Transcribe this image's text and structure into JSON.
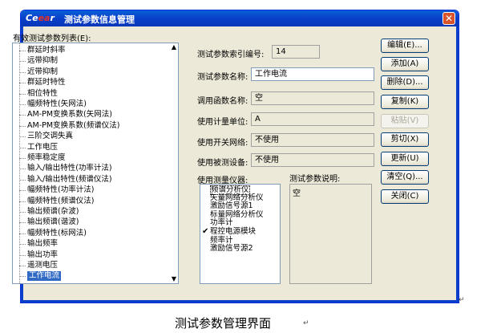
{
  "window": {
    "logo_prefix": "Ce",
    "logo_accent": "ea",
    "logo_suffix": "r",
    "title": "测试参数信息管理",
    "close_glyph": "✕"
  },
  "param_list": {
    "label": "有效测试参数列表(E):",
    "items": [
      "群延时斜率",
      "远带抑制",
      "近带抑制",
      "群延时特性",
      "相位特性",
      "幅频特性(矢网法)",
      "AM-PM变换系数(矢网法)",
      "AM-PM变换系数(频谱仪法)",
      "三阶交调失真",
      "工作电压",
      "频率稳定度",
      "输入/输出特性(功率计法)",
      "输入/输出特性(频谱仪法)",
      "幅频特性(功率计法)",
      "幅频特性(频谱仪法)",
      "输出频谱(杂波)",
      "输出频谱(谐波)",
      "幅频特性(标网法)",
      "输出频率",
      "输出功率",
      "遥测电压",
      "工作电流"
    ],
    "selected": "工作电流"
  },
  "fields": {
    "index_label": "测试参数索引编号:",
    "index_value": "14",
    "name_label": "测试参数名称:",
    "name_value": "工作电流",
    "func_label": "调用函数名称:",
    "func_value": "空",
    "unit_label": "使用计量单位:",
    "unit_value": "A",
    "switch_label": "使用开关网络:",
    "switch_value": "不使用",
    "dut_label": "使用被测设备:",
    "dut_value": "不使用",
    "instr_label": "使用测量仪器:",
    "desc_label": "测试参数说明:",
    "desc_value": "空"
  },
  "instruments": {
    "items": [
      "频谱分析仪",
      "矢量网络分析仪",
      "激励信号源1",
      "标量网络分析仪",
      "功率计",
      "程控电源模块",
      "频率计",
      "激励信号源2"
    ],
    "checked": "程控电源模块",
    "check_glyph": "✔"
  },
  "buttons": {
    "edit": "编辑(E)...",
    "add": "添加(A)",
    "delete": "删除(D)...",
    "copy": "复制(K)",
    "paste": "粘贴(V)",
    "cut": "剪切(X)",
    "update": "更新(U)",
    "clear": "清空(Q)...",
    "close": "关闭(C)"
  },
  "caption": "测试参数管理界面",
  "para_mark": "↵"
}
